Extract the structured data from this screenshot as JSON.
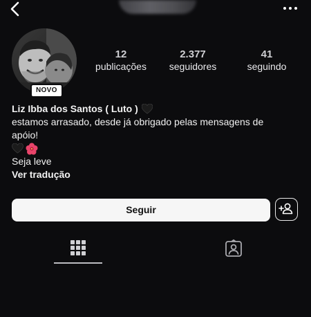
{
  "header": {
    "back_icon": "chevron-left-icon",
    "more_icon": "more-horizontal-icon"
  },
  "profile": {
    "badge": "NOVO",
    "stats": [
      {
        "value": "12",
        "label": "publicações"
      },
      {
        "value": "2.377",
        "label": "seguidores"
      },
      {
        "value": "41",
        "label": "seguindo"
      }
    ],
    "name": "Liz Ibba dos Santos ( Luto )",
    "bio_line1": "estamos arrasado, desde já obrigado pelas mensagens de",
    "bio_line2": "apóio!",
    "bio_line4": "Seja leve",
    "translate": "Ver tradução"
  },
  "actions": {
    "follow_label": "Seguir",
    "suggest_icon": "add-person-icon"
  },
  "tabs": [
    {
      "icon": "grid-icon",
      "active": true
    },
    {
      "icon": "tagged-icon",
      "active": false
    }
  ],
  "colors": {
    "background": "#0c0c0e",
    "button_bg": "#f6f6f6",
    "text": "#f5f5f5"
  }
}
